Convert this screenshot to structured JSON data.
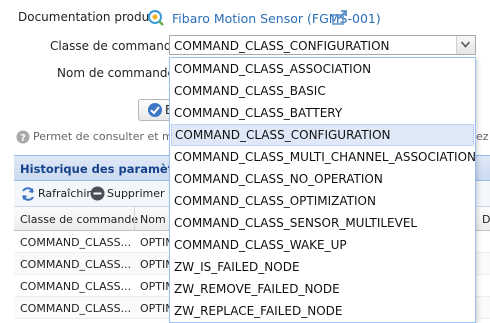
{
  "doc": {
    "label": "Documentation produit",
    "link": "Fibaro Motion Sensor (FGMS-001)"
  },
  "form": {
    "classe_label": "Classe de commande",
    "classe_value": "COMMAND_CLASS_CONFIGURATION",
    "nom_label": "Nom de commande",
    "exec_button_label": "E"
  },
  "help": {
    "text": "Permet de consulter et modi",
    "tail": "ez"
  },
  "history": {
    "title": "Historique des paramètres",
    "refresh_label": "Rafraîchir",
    "delete_label": "Supprimer",
    "columns": [
      "Classe de commande",
      "Nom c",
      "Do"
    ],
    "rows": [
      {
        "classe": "COMMAND_CLASS...",
        "nom": "OPTIM"
      },
      {
        "classe": "COMMAND_CLASS...",
        "nom": "OPTIM"
      },
      {
        "classe": "COMMAND_CLASS...",
        "nom": "OPTIM"
      },
      {
        "classe": "COMMAND_CLASS...",
        "nom": "OPTIM"
      }
    ]
  },
  "dropdown": {
    "selected_index": 3,
    "options": [
      "COMMAND_CLASS_ASSOCIATION",
      "COMMAND_CLASS_BASIC",
      "COMMAND_CLASS_BATTERY",
      "COMMAND_CLASS_CONFIGURATION",
      "COMMAND_CLASS_MULTI_CHANNEL_ASSOCIATION",
      "COMMAND_CLASS_NO_OPERATION",
      "COMMAND_CLASS_OPTIMIZATION",
      "COMMAND_CLASS_SENSOR_MULTILEVEL",
      "COMMAND_CLASS_WAKE_UP",
      "ZW_IS_FAILED_NODE",
      "ZW_REMOVE_FAILED_NODE",
      "ZW_REPLACE_FAILED_NODE"
    ]
  },
  "colors": {
    "link": "#2a6fb7",
    "panel_header": "#cbdaf0",
    "panel_title": "#15428b",
    "selected_option": "#dfe8f6"
  },
  "icons": {
    "doc": "help-circle-icon",
    "external": "external-link-icon",
    "dropdown": "chevron-down-icon",
    "exec": "check-circle-icon",
    "help": "question-circle-icon",
    "refresh": "refresh-icon",
    "delete": "minus-circle-icon"
  }
}
